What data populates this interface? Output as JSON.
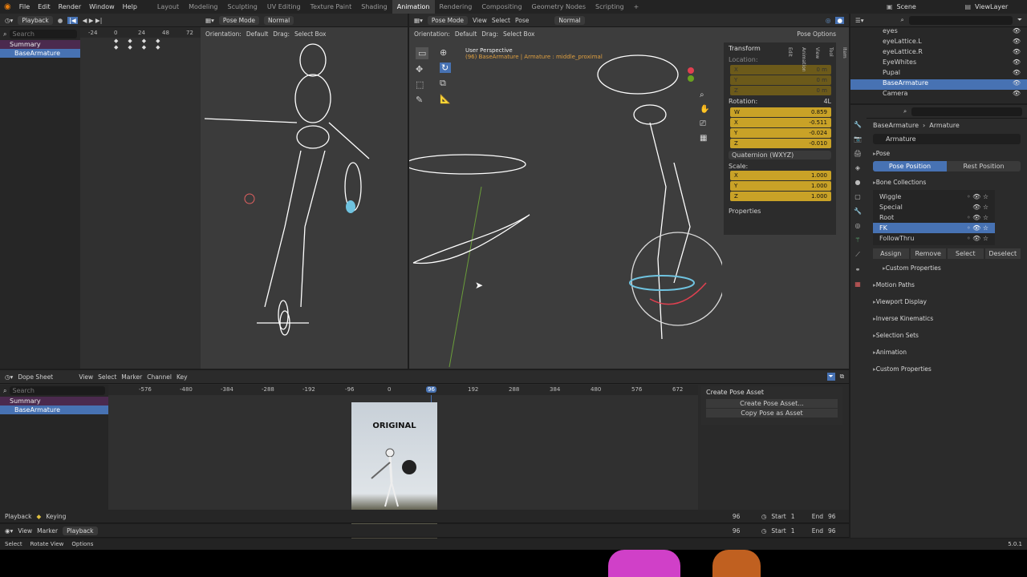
{
  "topbar": {
    "menus": [
      "File",
      "Edit",
      "Render",
      "Window",
      "Help"
    ],
    "workspaces": [
      "Layout",
      "Modeling",
      "Sculpting",
      "UV Editing",
      "Texture Paint",
      "Shading",
      "Animation",
      "Rendering",
      "Compositing",
      "Geometry Nodes",
      "Scripting"
    ],
    "active_workspace": "Animation",
    "scene": "Scene",
    "view_layer": "ViewLayer",
    "add_tab": "+"
  },
  "dopesheet_top": {
    "mode": "Playback",
    "ruler": [
      "-24",
      "0",
      "24",
      "48",
      "72"
    ],
    "channels": [
      "Summary",
      "BaseArmature"
    ],
    "search_placeholder": "Search"
  },
  "viewport_left": {
    "mode": "Pose Mode",
    "shading": "Normal",
    "orientation_label": "Orientation:",
    "orientation": "Default",
    "drag_label": "Drag:",
    "drag": "Select Box"
  },
  "viewport_right": {
    "mode": "Pose Mode",
    "menus": [
      "View",
      "Select",
      "Pose"
    ],
    "shading": "Normal",
    "orientation_label": "Orientation:",
    "orientation": "Default",
    "drag_label": "Drag:",
    "drag": "Select Box",
    "pose_options": "Pose Options",
    "info_line1": "User Perspective",
    "info_line2": "(96) BaseArmature | Armature : middle_proximal",
    "transform": {
      "title": "Transform",
      "location_label": "Location:",
      "location": [
        {
          "axis": "X",
          "value": "0 m"
        },
        {
          "axis": "Y",
          "value": "0 m"
        },
        {
          "axis": "Z",
          "value": "0 m"
        }
      ],
      "rotation_label": "Rotation:",
      "rotation_mode_tag": "4L",
      "rotation": [
        {
          "axis": "W",
          "value": "0.859"
        },
        {
          "axis": "X",
          "value": "-0.511"
        },
        {
          "axis": "Y",
          "value": "-0.024"
        },
        {
          "axis": "Z",
          "value": "-0.010"
        }
      ],
      "rotation_mode": "Quaternion (WXYZ)",
      "scale_label": "Scale:",
      "scale": [
        {
          "axis": "X",
          "value": "1.000"
        },
        {
          "axis": "Y",
          "value": "1.000"
        },
        {
          "axis": "Z",
          "value": "1.000"
        }
      ],
      "properties": "Properties"
    },
    "side_tabs": [
      "Item",
      "Tool",
      "View",
      "Animation",
      "Edit"
    ]
  },
  "outliner": {
    "search_placeholder": "",
    "items": [
      {
        "label": "eyes"
      },
      {
        "label": "eyeLattice.L"
      },
      {
        "label": "eyeLattice.R"
      },
      {
        "label": "EyeWhites"
      },
      {
        "label": "Pupal"
      },
      {
        "label": "BaseArmature"
      },
      {
        "label": "Camera"
      }
    ]
  },
  "properties_panel": {
    "breadcrumb_object": "BaseArmature",
    "breadcrumb_data": "Armature",
    "name": "Armature",
    "pose_section": "Pose",
    "pose_position": "Pose Position",
    "rest_position": "Rest Position",
    "bone_collections_section": "Bone Collections",
    "collections": [
      "Wiggle",
      "Special",
      "Root",
      "FK",
      "FollowThru"
    ],
    "selected_collection": "FK",
    "buttons": [
      "Assign",
      "Remove",
      "Select",
      "Deselect"
    ],
    "sections": [
      "Custom Properties",
      "Motion Paths",
      "Viewport Display",
      "Inverse Kinematics",
      "Selection Sets",
      "Animation",
      "Custom Properties"
    ]
  },
  "dopesheet_bottom": {
    "editor": "Dope Sheet",
    "menus": [
      "View",
      "Select",
      "Marker",
      "Channel",
      "Key"
    ],
    "search_placeholder": "Search",
    "ruler": [
      "-576",
      "-480",
      "-384",
      "-288",
      "-192",
      "-96",
      "0",
      "96",
      "192",
      "288",
      "384",
      "480",
      "576",
      "672"
    ],
    "current_frame": "96",
    "channels": [
      "Summary",
      "BaseArmature"
    ],
    "pose_asset_title": "Create Pose Asset",
    "create_pose_asset": "Create Pose Asset...",
    "copy_pose_asset": "Copy Pose as Asset",
    "overlay_label": "ORIGINAL"
  },
  "playback_bar_1": {
    "playback": "Playback",
    "keying": "Keying",
    "frame": "96",
    "start_label": "Start",
    "start": "1",
    "end_label": "End",
    "end": "96"
  },
  "playback_bar_2": {
    "menus": [
      "View",
      "Marker",
      "Playback"
    ],
    "frame": "96",
    "start_label": "Start",
    "start": "1",
    "end_label": "End",
    "end": "96"
  },
  "statusbar": {
    "items": [
      "Select",
      "Rotate View",
      "Options"
    ],
    "version": "5.0.1"
  },
  "colors": {
    "accent": "#4772b3",
    "active_field": "#c9a227",
    "background": "#1d1d1d"
  }
}
